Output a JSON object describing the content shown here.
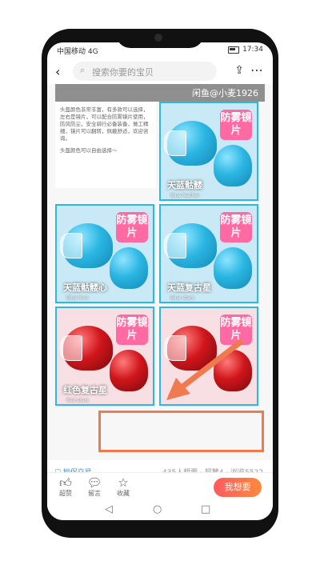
{
  "status_bar": {
    "left": "中国移动 4G",
    "time": "17:34"
  },
  "search": {
    "placeholder": "搜索你要的宝贝"
  },
  "watermark": "闲鱼@小麦1926",
  "description": [
    "头盔颜色非常丰富，有多款可以选择，左右是镜片，可以配合防雾镜片使用，防风防尘，安全骑行必备装备，做工精细，镜片可以翻转，佩戴舒适，欢迎咨询。",
    "头盔颜色可以自由选择～"
  ],
  "tiles": [
    {
      "badge": "防雾镜片",
      "name": "天蓝骷髅",
      "sub": "Blue leather",
      "color": "blue"
    },
    {
      "badge": "防雾镜片",
      "name": "天蓝骷髅心",
      "sub": "Blue love",
      "color": "blue"
    },
    {
      "badge": "防雾镜片",
      "name": "天蓝复古星",
      "sub": "Blue stars",
      "color": "blue"
    },
    {
      "badge": "防雾镜片",
      "name": "红色复古星",
      "sub": "Red stars",
      "color": "red"
    },
    {
      "badge": "防雾镜片",
      "name": "",
      "sub": "",
      "color": "red"
    }
  ],
  "guarantee": "担保交易",
  "stats": "435人想要 · 超赞4 · 浏览5522",
  "actions": {
    "like": "超赞",
    "comment": "留言",
    "favorite": "收藏",
    "want": "我想要"
  },
  "colors": {
    "accent": "#ff5a5f",
    "highlight": "#f07a4f",
    "tile_border": "#2ab8e8",
    "badge": "#ff6aa3"
  }
}
